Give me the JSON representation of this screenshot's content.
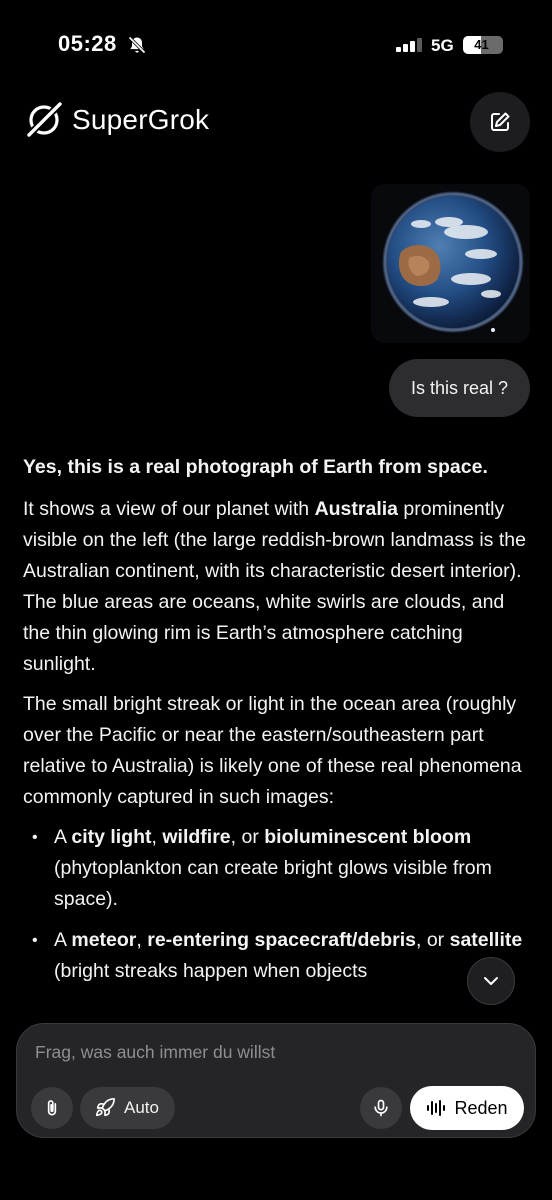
{
  "status_bar": {
    "time": "05:28",
    "network": "5G",
    "battery_percent": "41",
    "icons": [
      "bell-off-icon",
      "signal-icon",
      "battery-icon"
    ]
  },
  "header": {
    "app_name": "SuperGrok",
    "icons": [
      "grok-logo-icon",
      "edit-icon"
    ]
  },
  "conversation": {
    "user_image_description_icon": "earth-photo",
    "user_message": "Is this real ?",
    "response": {
      "lead": "Yes, this is a real photograph of Earth from space.",
      "p1_before": "It shows a view of our planet with ",
      "p1_bold": "Australia",
      "p1_after": " prominently visible on the left (the large reddish-brown landmass is the Australian continent, with its characteristic desert interior). The blue areas are oceans, white swirls are clouds, and the thin glowing rim is Earth’s atmosphere catching sunlight.",
      "p2": "The small bright streak or light in the ocean area (roughly over the Pacific or near the eastern/southeastern part relative to Australia) is likely one of these real phenomena commonly captured in such images:",
      "bullets": [
        {
          "pre": "A ",
          "b1": "city light",
          "mid1": ", ",
          "b2": "wildfire",
          "mid2": ", or ",
          "b3": "bioluminescent bloom",
          "post": " (phytoplankton can create bright glows visible from space)."
        },
        {
          "pre": "A ",
          "b1": "meteor",
          "mid1": ", ",
          "b2": "re-entering spacecraft/debris",
          "mid2": ", or ",
          "b3": "satellite",
          "post": " (bright streaks happen when objects"
        }
      ]
    }
  },
  "composer": {
    "placeholder": "Frag, was auch immer du willst",
    "mode_label": "Auto",
    "talk_label": "Reden",
    "icons": [
      "paperclip-icon",
      "rocket-icon",
      "mic-icon",
      "waveform-icon",
      "chevron-down-icon"
    ]
  },
  "colors": {
    "background": "#000000",
    "bubble": "#2d2d2f",
    "button": "#3a3a3c",
    "talk_button": "#ffffff"
  }
}
